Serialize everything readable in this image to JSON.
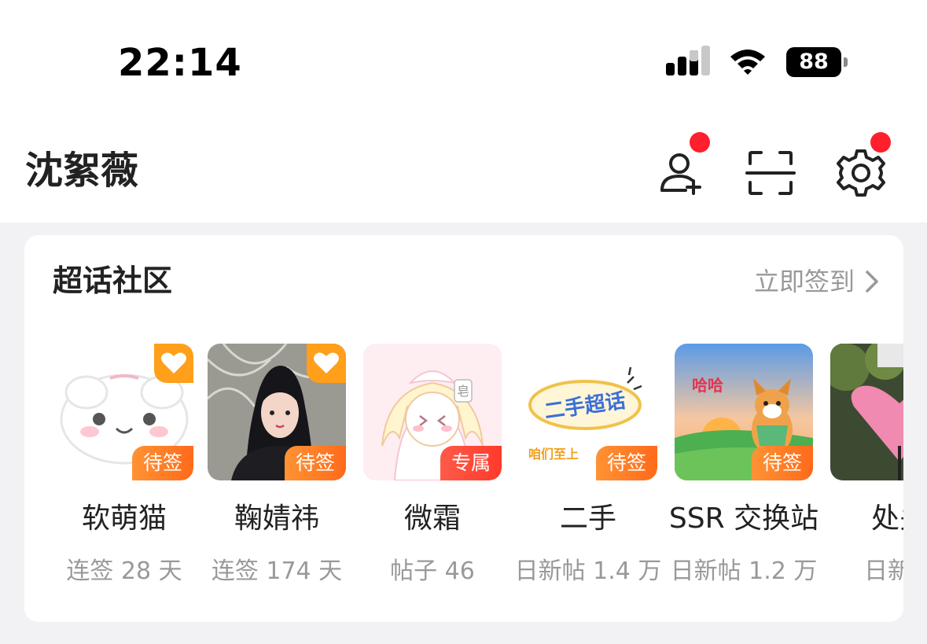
{
  "status_bar": {
    "time": "22:14",
    "battery": "88"
  },
  "header": {
    "username": "沈絮薇"
  },
  "community": {
    "title": "超话社区",
    "action_label": "立即签到",
    "items": [
      {
        "name": "软萌猫",
        "subtitle": "连签 28 天",
        "tag": "待签",
        "favorite": true
      },
      {
        "name": "鞠婧祎",
        "subtitle": "连签 174 天",
        "tag": "待签",
        "favorite": true
      },
      {
        "name": "微霜",
        "subtitle": "帖子 46",
        "tag": "专属",
        "favorite": false,
        "thumb_text": "皂"
      },
      {
        "name": "二手",
        "subtitle": "日新帖 1.4 万",
        "tag": "待签",
        "favorite": false,
        "thumb_text": "二手超话",
        "thumb_text2": "咱们至上"
      },
      {
        "name": "SSR 交换站",
        "subtitle": "日新帖 1.2 万",
        "tag": "待签",
        "favorite": false,
        "thumb_text": "哈哈"
      },
      {
        "name": "处关",
        "subtitle": "日新帖",
        "tag": "",
        "favorite": false
      }
    ]
  },
  "colors": {
    "accent_orange": "#ff7a1a",
    "badge_red": "#ff1f2d",
    "muted_text": "#999999"
  }
}
